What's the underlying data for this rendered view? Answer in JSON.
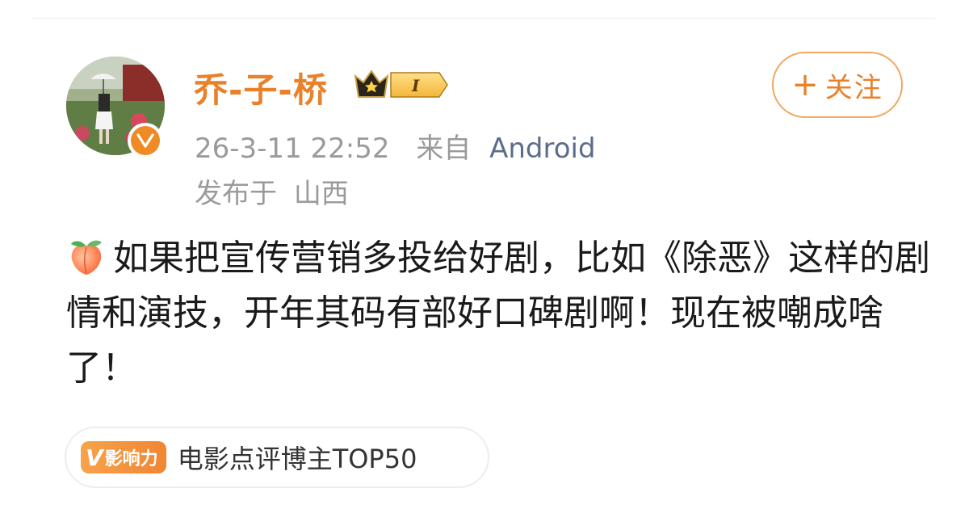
{
  "user": {
    "name": "乔-子-桥",
    "vip_level": "I",
    "avatar_icon": "avatar-photo",
    "verified_icon": "verified-badge-icon"
  },
  "follow": {
    "plus": "+",
    "label": "关注"
  },
  "meta": {
    "timestamp": "26-3-11 22:52",
    "source_prefix": "来自",
    "source": "Android",
    "location_prefix": "发布于",
    "location": "山西"
  },
  "post": {
    "emoji_icon": "peach-icon",
    "text": "如果把宣传营销多投给好剧，比如《除恶》这样的剧情和演技，开年其码有部好口碑剧啊！现在被嘲成啥了！"
  },
  "influence": {
    "tag_v": "V",
    "tag_label": "影响力",
    "text": "电影点评博主TOP50"
  },
  "colors": {
    "accent": "#e8812a",
    "source_link": "#5b6d8a",
    "meta_gray": "#9a9a9a"
  }
}
